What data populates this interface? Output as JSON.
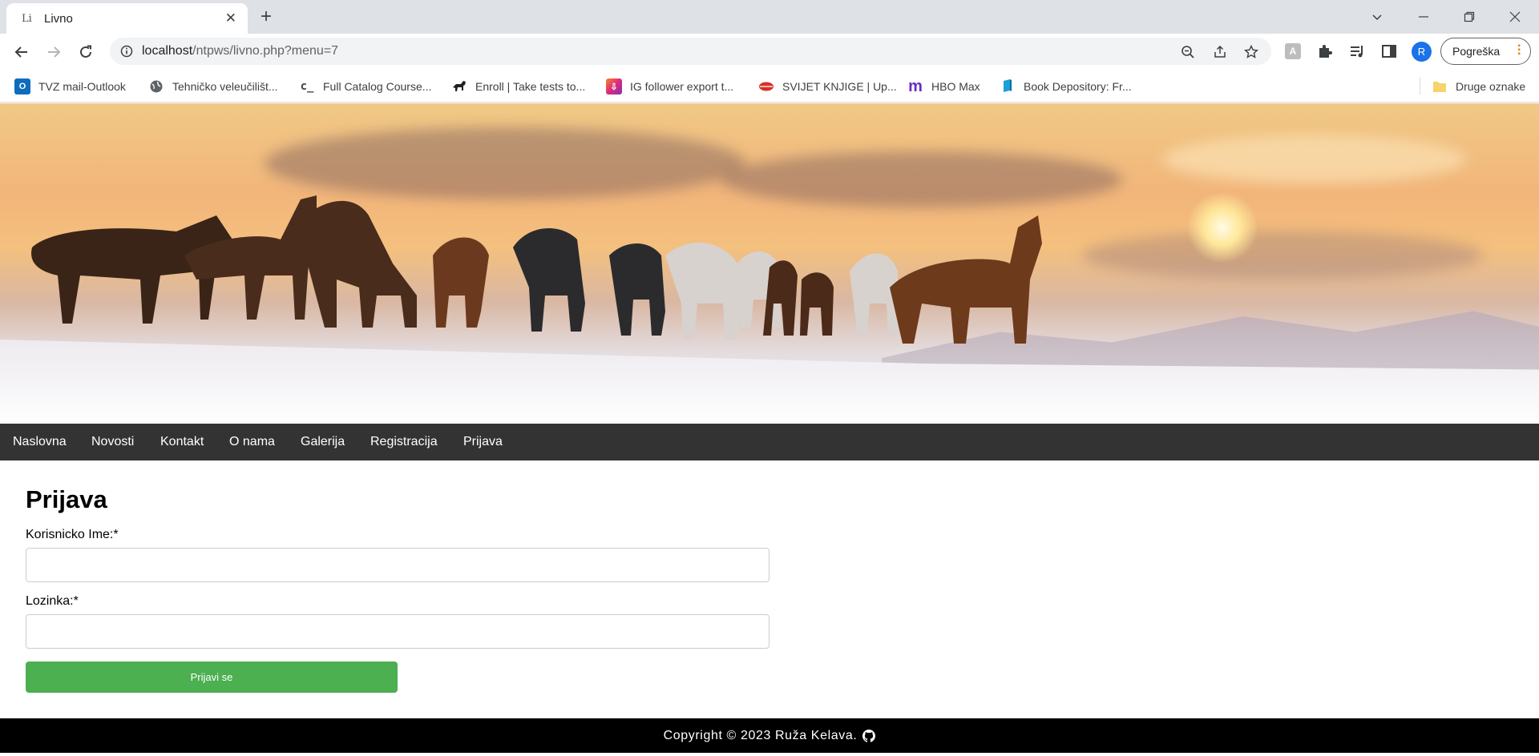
{
  "browser": {
    "tab": {
      "favicon_text": "Li",
      "title": "Livno"
    },
    "url": {
      "host": "localhost",
      "path": "/ntpws/livno.php?menu=7"
    },
    "profile_initial": "R",
    "error_label": "Pogreška",
    "bookmarks": [
      {
        "label": "TVZ mail-Outlook",
        "icon": "outlook-icon",
        "color": "#0f6cbd"
      },
      {
        "label": "Tehničko veleučilišt...",
        "icon": "globe-icon",
        "color": "#5f6368"
      },
      {
        "label": "Full Catalog Course...",
        "icon": "course-icon",
        "color": "#3c4043"
      },
      {
        "label": "Enroll | Take tests to...",
        "icon": "horse-icon",
        "color": "#202124"
      },
      {
        "label": "IG follower export t...",
        "icon": "ig-export-icon",
        "color": "#e4405f"
      },
      {
        "label": "SVIJET KNJIGE | Up...",
        "icon": "lips-icon",
        "color": "#d93025"
      },
      {
        "label": "HBO Max",
        "icon": "hbo-max-icon",
        "color": "#6b2cc2"
      },
      {
        "label": "Book Depository: Fr...",
        "icon": "book-icon",
        "color": "#1aa0d8"
      }
    ],
    "other_bookmarks": "Druge oznake"
  },
  "nav": {
    "items": [
      "Naslovna",
      "Novosti",
      "Kontakt",
      "O nama",
      "Galerija",
      "Registracija",
      "Prijava"
    ]
  },
  "form": {
    "title": "Prijava",
    "username_label": "Korisnicko Ime:*",
    "username_value": "",
    "password_label": "Lozinka:*",
    "password_value": "",
    "submit_label": "Prijavi se"
  },
  "footer": {
    "text": "Copyright © 2023 Ruža Kelava."
  },
  "colors": {
    "navbar": "#333333",
    "submit": "#4caf50",
    "footer": "#000000"
  }
}
